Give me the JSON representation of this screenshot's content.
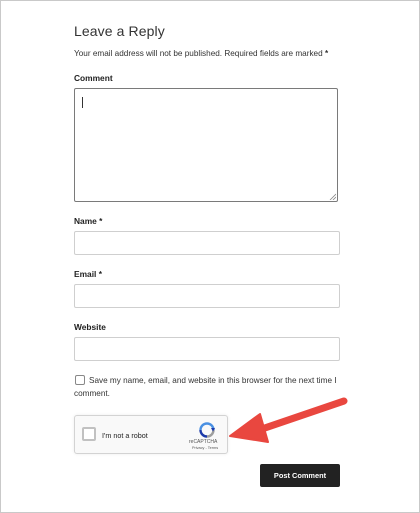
{
  "form": {
    "title": "Leave a Reply",
    "notes": "Your email address will not be published. Required fields are marked",
    "required_mark": "*",
    "comment_label": "Comment",
    "name_label": "Name",
    "email_label": "Email",
    "website_label": "Website",
    "consent_line1": "Save my name, email, and website in this browser for the next time I",
    "consent_line2": "comment.",
    "submit_label": "Post Comment"
  },
  "recaptcha": {
    "label": "I'm not a robot",
    "brand": "reCAPTCHA",
    "links": "Privacy - Terms"
  },
  "colors": {
    "submit_bg": "#222222",
    "annotation_arrow": "#e9473f",
    "recaptcha_blue": "#4a90e2"
  },
  "icons": {
    "recaptcha_logo": "recaptcha-logo-icon",
    "annotation_arrow": "red-arrow-annotation"
  }
}
